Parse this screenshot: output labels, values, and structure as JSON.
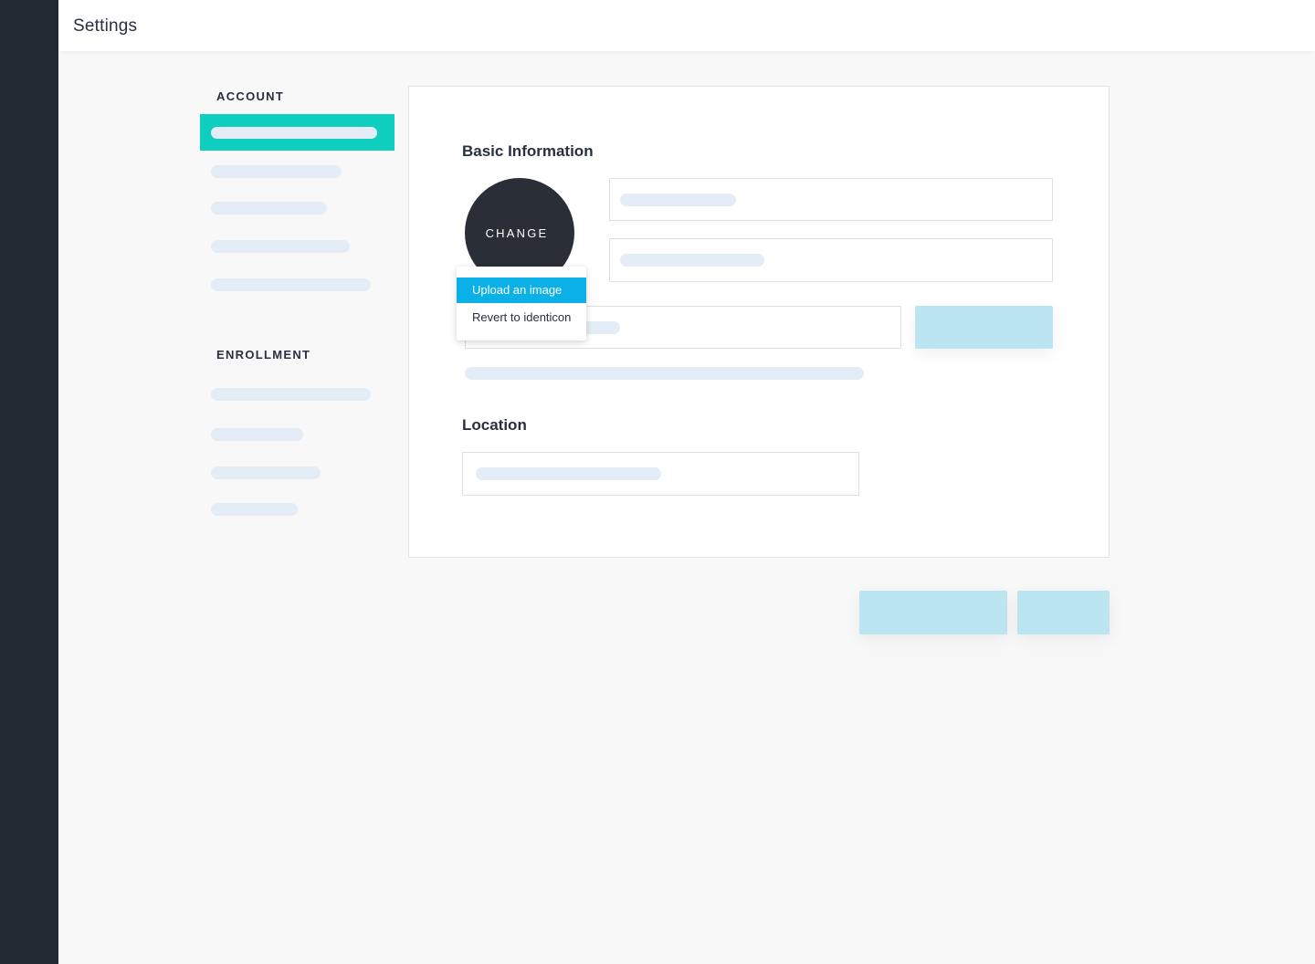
{
  "header": {
    "title": "Settings"
  },
  "sidebar": {
    "sections": [
      {
        "label": "ACCOUNT"
      },
      {
        "label": "ENROLLMENT"
      }
    ]
  },
  "card": {
    "basic_heading": "Basic Information",
    "location_heading": "Location",
    "avatar_label": "CHANGE"
  },
  "avatar_menu": {
    "items": [
      {
        "label": "Upload an image"
      },
      {
        "label": "Revert to identicon"
      }
    ]
  },
  "colors": {
    "rail": "#222b33",
    "active_nav": "#0ecfbf",
    "menu_highlight": "#0bb1e6",
    "placeholder_button": "#bbe5f0",
    "skeleton": "#e4edf5"
  }
}
